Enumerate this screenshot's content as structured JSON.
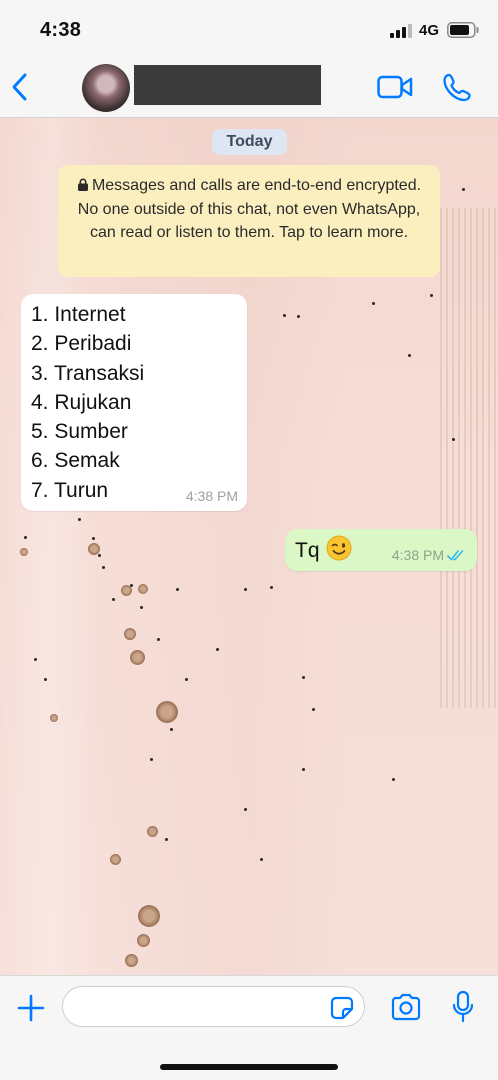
{
  "status_bar": {
    "time": "4:38",
    "network": "4G"
  },
  "header": {
    "back_icon": "chevron-left-icon",
    "video_icon": "video-icon",
    "call_icon": "phone-icon"
  },
  "chat": {
    "date_chip": "Today",
    "encryption_notice": "Messages and calls are end-to-end encrypted. No one outside of this chat, not even WhatsApp, can read or listen to them. Tap to learn more.",
    "messages": [
      {
        "direction": "incoming",
        "lines": [
          "1. Internet",
          "2. Peribadi",
          "3. Transaksi",
          "4. Rujukan",
          "5. Sumber",
          "6. Semak",
          "7. Turun"
        ],
        "time": "4:38 PM"
      },
      {
        "direction": "outgoing",
        "text": "Tq",
        "emoji": "winking-face",
        "time": "4:38 PM",
        "status": "read"
      }
    ]
  },
  "composer": {
    "placeholder": ""
  },
  "colors": {
    "accent": "#007aff",
    "read_ticks": "#34b7f1",
    "outgoing_bubble": "#dcf7c6",
    "notice_bg": "#fbefc0"
  }
}
